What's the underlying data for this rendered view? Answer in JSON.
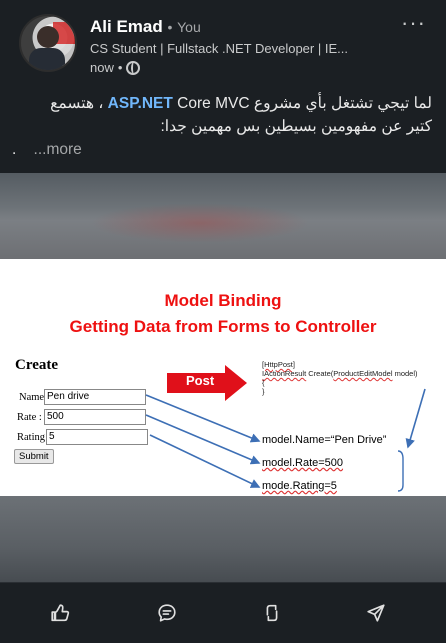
{
  "author": {
    "name": "Ali Emad",
    "separator": "•",
    "you": "You",
    "headline": "CS Student | Fullstack .NET Developer | IE...",
    "time": "now",
    "time_separator": "•"
  },
  "more_options": "···",
  "post": {
    "line1_pre": "لما تيجي تشتغل بأي مشروع ",
    "line1_hl": "ASP.NET",
    "line1_mid": " Core MVC ",
    "line1_post": "، هتسمع",
    "line2": "كتير عن مفهومين بسيطين بس مهمين جدا:",
    "line3_dot": ".",
    "more": "...more"
  },
  "slide": {
    "title1": "Model Binding",
    "title2": "Getting Data from Forms to Controller",
    "create": "Create",
    "post_label": "Post",
    "form": {
      "name_label": "Name",
      "name_value": "Pen drive",
      "rate_label": "Rate :",
      "rate_value": "500",
      "rating_label": "Rating",
      "rating_value": "5",
      "submit": "Submit"
    },
    "code_attr": "[HttpPost]",
    "code_sig_a": "IActionResult",
    "code_sig_b": " Create(",
    "code_sig_c": "ProductEditModel",
    "code_sig_d": " model)",
    "code_open": "{",
    "code_close": "}",
    "expr1_pre": "model.Name=",
    "expr1_val": "“Pen Drive”",
    "expr2": "model.Rate=500",
    "expr3": "mode.Rating=5"
  },
  "toolbar": {
    "like": "like-icon",
    "comment": "comment-icon",
    "repost": "repost-icon",
    "send": "send-icon"
  },
  "colors": {
    "background": "#1b1f23",
    "link": "#71b7fb",
    "slide_title": "#ee1111",
    "arrow_blue": "#3d6fb5",
    "post_arrow": "#e0101a"
  }
}
